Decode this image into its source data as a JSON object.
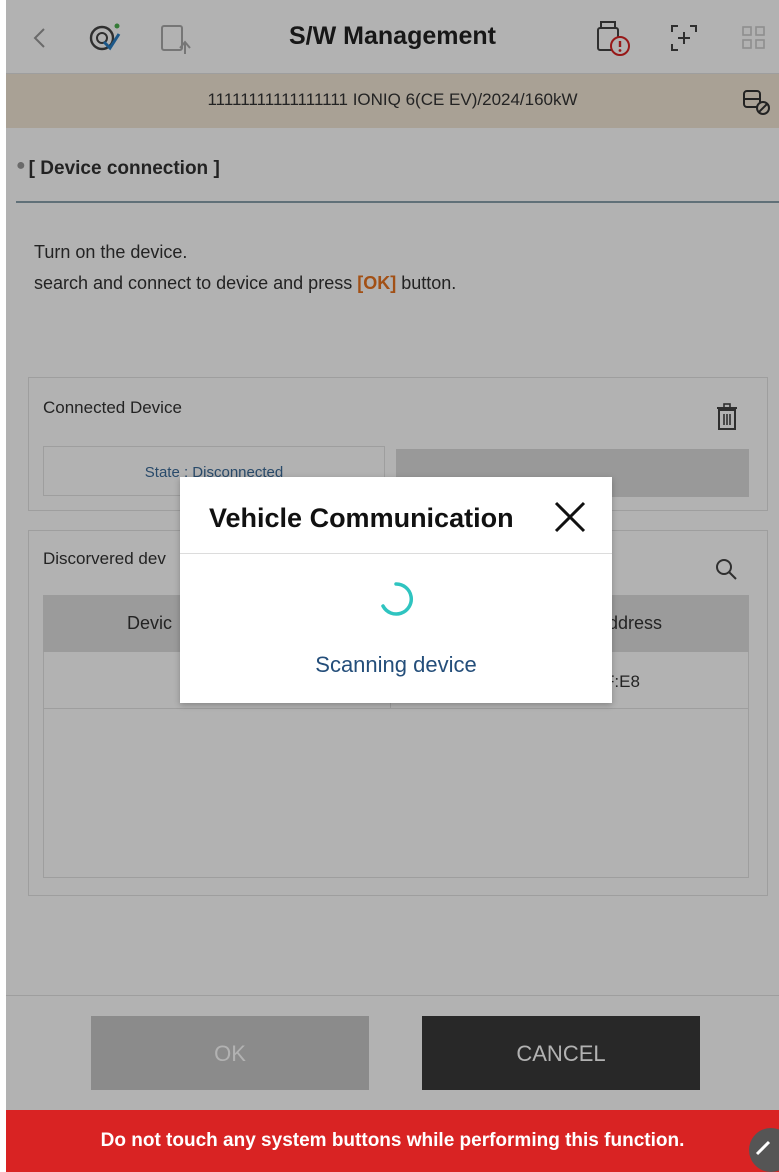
{
  "header": {
    "title": "S/W Management"
  },
  "vehicle_info": {
    "text": "11111111111111111  IONIQ 6(CE EV)/2024/160kW"
  },
  "section": {
    "title": "[ Device connection ]",
    "instruction_line1": "Turn on the device.",
    "instruction_line2_pre": "search and connect to device and press ",
    "instruction_ok": "[OK]",
    "instruction_line2_post": " button."
  },
  "connected_device": {
    "label": "Connected Device",
    "state": "State : Disconnected"
  },
  "discovered_devices": {
    "label": "Discorvered dev",
    "col1_header": "Devic",
    "col2_header": "ddress",
    "row1_col2": "F:E8"
  },
  "buttons": {
    "ok": "OK",
    "cancel": "CANCEL"
  },
  "warning": {
    "text": "Do not touch any system buttons while performing this function."
  },
  "modal": {
    "title": "Vehicle Communication",
    "message": "Scanning device"
  },
  "colors": {
    "accent_orange": "#e8731f",
    "warning_red": "#d92323",
    "spinner_teal": "#2fc4c0",
    "link_blue": "#244e7a"
  }
}
